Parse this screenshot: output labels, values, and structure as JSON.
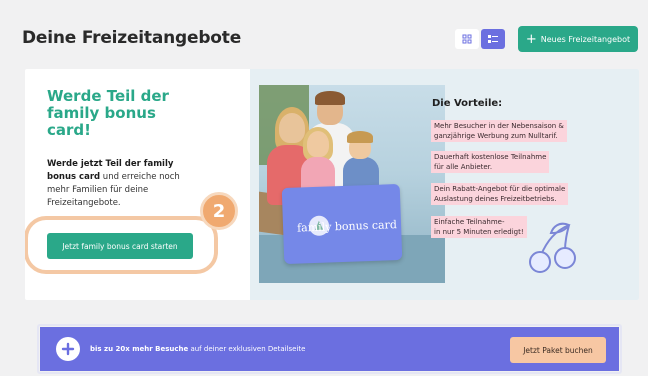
{
  "page": {
    "title": "Deine Freizeitangebote"
  },
  "toolbar": {
    "grid_view_icon": "grid-icon",
    "list_view_icon": "list-icon",
    "new_button_label": "Neues Freizeitangebot",
    "new_button_icon": "plus-icon"
  },
  "promo": {
    "heading": "Werde Teil der family bonus card!",
    "text_bold_1": "Werde jetzt Teil der family bonus card",
    "text_rest": " und erreiche noch mehr Familien für deine Freizeitangebote.",
    "start_button": "Jetzt family bonus card starten",
    "step_number": "2",
    "card_label": "family bonus card",
    "benefits_title": "Die Vorteile:",
    "benefits": [
      {
        "line1": "Mehr Besucher in der Nebensaison &",
        "line2": "ganzjährige Werbung zum Nulltarif."
      },
      {
        "line1": "Dauerhaft kostenlose Teilnahme",
        "line2": "für alle Anbieter."
      },
      {
        "line1": "Dein Rabatt-Angebot für die optimale",
        "line2": "Auslastung deines Freizeitbetriebs."
      },
      {
        "line1": "Einfache Teilnahme-",
        "line2": "in nur 5 Minuten erledigt!"
      }
    ]
  },
  "upsell": {
    "text_pre": "bis zu 20x mehr Besuche",
    "text_post": " auf deiner exklusiven Detailseite",
    "button": "Jetzt Paket buchen"
  },
  "colors": {
    "accent_green": "#2aa889",
    "accent_purple": "#6b6fe0",
    "highlight_orange": "#f0a970",
    "benefit_pink": "#fbd4dc"
  }
}
